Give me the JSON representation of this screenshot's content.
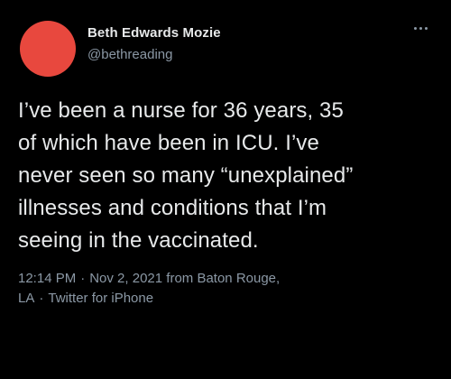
{
  "author": {
    "display_name": "Beth Edwards Mozie",
    "handle": "@bethreading",
    "avatar_color": "#e8483e"
  },
  "menu": {
    "icon": "more-options-icon"
  },
  "tweet": {
    "text_lines": [
      "I’ve been a nurse for 36 years, 35",
      "of which have been in ICU.  I’ve",
      "never seen so many “unexplained”",
      "illnesses and conditions that I’m",
      "seeing in the vaccinated."
    ]
  },
  "meta": {
    "time": "12:14 PM",
    "separator": "·",
    "date": "Nov 2, 2021",
    "location_part1": "from Baton Rouge,",
    "location_part2": "LA",
    "source": "Twitter for iPhone"
  }
}
